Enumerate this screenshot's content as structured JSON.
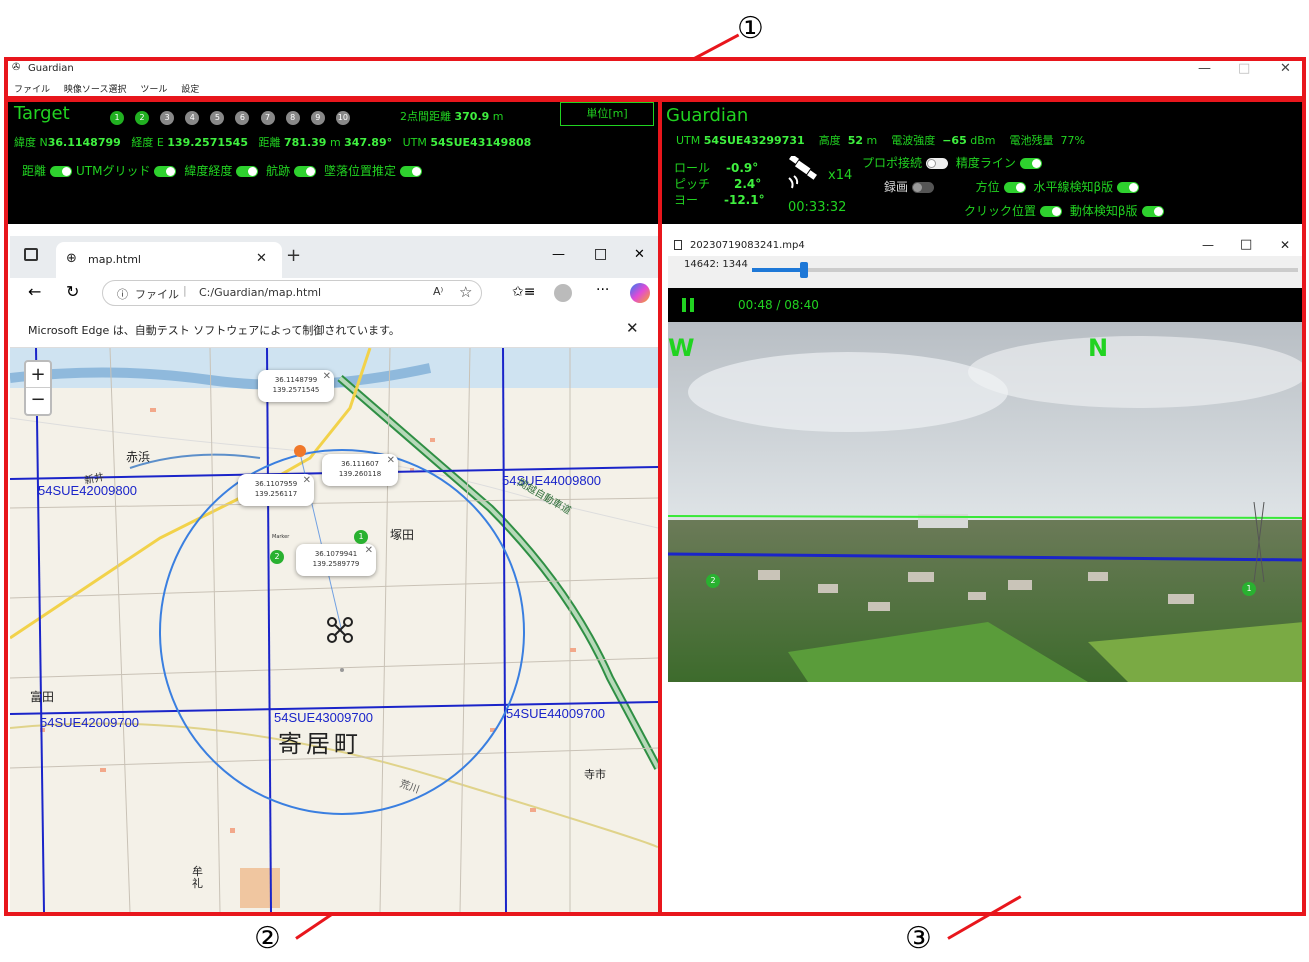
{
  "callouts": [
    "①",
    "②",
    "③"
  ],
  "app": {
    "title": "Guardian",
    "menu": [
      "ファイル",
      "映像ソース選択",
      "ツール",
      "設定"
    ],
    "controls": [
      "—",
      "□",
      "✕"
    ]
  },
  "target_panel": {
    "title": "Target",
    "numbers": [
      "1",
      "2",
      "3",
      "4",
      "5",
      "6",
      "7",
      "8",
      "9",
      "10"
    ],
    "distance_label": "2点間距離",
    "distance_value": "370.9",
    "distance_unit": "m",
    "unit_button": "単位[m]",
    "lat_label": "緯度",
    "lat_prefix": "N",
    "lat_value": "36.1148799",
    "lon_label": "経度",
    "lon_prefix": "E",
    "lon_value": "139.2571545",
    "dist_label": "距離",
    "dist_value": "781.39",
    "dist_unit": "m",
    "bearing": "347.89°",
    "utm_label": "UTM",
    "utm_value": "54SUE43149808",
    "toggles": [
      "距離",
      "UTMグリッド",
      "緯度経度",
      "航跡",
      "墜落位置推定"
    ]
  },
  "guardian_panel": {
    "title": "Guardian",
    "utm_label": "UTM",
    "utm_value": "54SUE43299731",
    "alt_label": "高度",
    "alt_value": "52",
    "alt_unit": "m",
    "signal_label": "電波強度",
    "signal_value": "−65",
    "signal_unit": "dBm",
    "battery_label": "電池残量",
    "battery_value": "77%",
    "roll_label": "ロール",
    "roll_value": "-0.9°",
    "pitch_label": "ピッチ",
    "pitch_value": "2.4°",
    "yaw_label": "ヨー",
    "yaw_value": "-12.1°",
    "sat_count": "x14",
    "elapsed": "00:33:32",
    "toggles": {
      "propo": "プロポ接続",
      "accuracy": "精度ライン",
      "record": "録画",
      "heading": "方位",
      "horizon": "水平線検知β版",
      "click_pos": "クリック位置",
      "motion": "動体検知β版"
    }
  },
  "browser": {
    "tab_title": "map.html",
    "new_tab": "+",
    "address_prefix": "ファイル",
    "address": "C:/Guardian/map.html",
    "info_message": "Microsoft Edge は、自動テスト ソフトウェアによって制御されています。",
    "window_controls": [
      "—",
      "□",
      "✕"
    ]
  },
  "map": {
    "zoom_in": "+",
    "zoom_out": "−",
    "grid_labels": [
      "54SUE42009800",
      "54SUE44009800",
      "54SUE42009700",
      "54SUE43009700",
      "54SUE44009700"
    ],
    "town_name": "寄居町",
    "place_labels": [
      "赤浜",
      "塚田",
      "富田",
      "寺市",
      "牟礼",
      "新井"
    ],
    "popups": [
      {
        "lat": "36.1148799",
        "lon": "139.2571545"
      },
      {
        "lat": "36.111607",
        "lon": "139.260118"
      },
      {
        "lat": "36.1107959",
        "lon": "139.256117"
      },
      {
        "lat": "36.1079941",
        "lon": "139.2589779"
      }
    ],
    "pins": [
      "1",
      "2"
    ],
    "marker_label": "Marker",
    "roads": [
      "関越自動車道",
      "新荒川",
      "荒川"
    ]
  },
  "video": {
    "filename": "20230719083241.mp4",
    "frame_info": "14642: 1344",
    "progress": 0.095,
    "time": "00:48 / 08:40",
    "compass_w": "W",
    "compass_n": "N",
    "pins": [
      "2",
      "1"
    ]
  },
  "colors": {
    "accent_red": "#e8161c",
    "hud_green": "#21d321",
    "grid_blue": "#1a24c9"
  }
}
